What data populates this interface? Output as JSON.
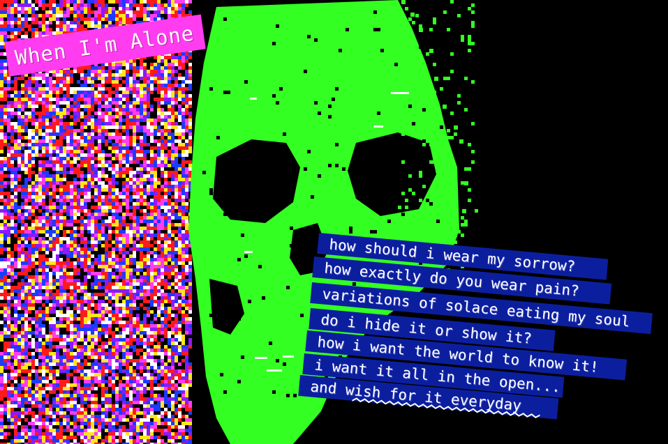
{
  "title": "When I'm Alone",
  "lyrics": {
    "line1": "how should i wear my sorrow?",
    "line2": "how exactly do you wear pain?",
    "line3": "variations of solace eating my soul",
    "line4": "do i hide it or show it?",
    "line5": "how i want the world to know it!",
    "line6": "i want it all in the open...",
    "line7": "and wish for it everyday"
  },
  "colors": {
    "background": "#000000",
    "skull": "#33ff22",
    "title_bg": "#ff3cf0",
    "lyric_bg": "#0b1f9e",
    "noise": [
      "#ff1a1a",
      "#1a3cff",
      "#ffe61a",
      "#ff3cf0",
      "#000000",
      "#ffffff",
      "#8a1aff"
    ]
  },
  "icons": [
    "skull-illustration",
    "glitch-noise-pattern"
  ]
}
